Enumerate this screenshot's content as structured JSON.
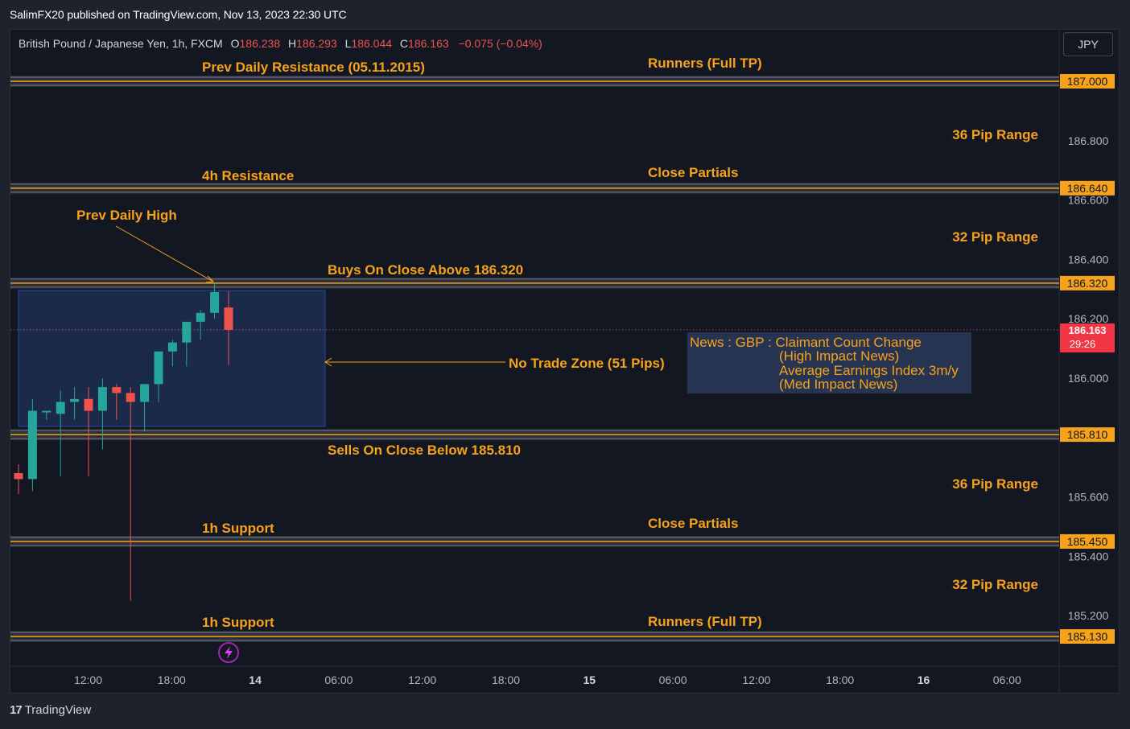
{
  "header": {
    "publisher": "SalimFX20 published on TradingView.com, Nov 13, 2023 22:30 UTC"
  },
  "legend": {
    "symbol": "British Pound / Japanese Yen, 1h, FXCM",
    "o_label": "O",
    "o_value": "186.238",
    "h_label": "H",
    "h_value": "186.293",
    "l_label": "L",
    "l_value": "186.044",
    "c_label": "C",
    "c_value": "186.163",
    "change": "−0.075 (−0.04%)"
  },
  "currency_button": "JPY",
  "footer": {
    "brand": "TradingView"
  },
  "colors": {
    "up": "#26a69a",
    "down": "#ef5350",
    "annotation": "#f7a21b",
    "background": "#131722",
    "zone_fill": "#1b2a48",
    "zone_border": "#2962ff"
  },
  "chart_data": {
    "type": "candlestick",
    "ylim": [
      185.03,
      187.09
    ],
    "price_axis_ticks": [
      "186.800",
      "186.600",
      "186.400",
      "186.200",
      "186.000",
      "185.600",
      "185.400",
      "185.200"
    ],
    "time_axis_ticks": [
      "12:00",
      "18:00",
      "14",
      "06:00",
      "12:00",
      "18:00",
      "15",
      "06:00",
      "12:00",
      "18:00",
      "16",
      "06:00"
    ],
    "candles": [
      {
        "o": 185.68,
        "h": 185.71,
        "l": 185.61,
        "c": 185.66
      },
      {
        "o": 185.66,
        "h": 185.93,
        "l": 185.62,
        "c": 185.89
      },
      {
        "o": 185.89,
        "h": 185.89,
        "l": 185.86,
        "c": 185.89
      },
      {
        "o": 185.88,
        "h": 185.96,
        "l": 185.67,
        "c": 185.92
      },
      {
        "o": 185.92,
        "h": 185.97,
        "l": 185.86,
        "c": 185.93
      },
      {
        "o": 185.93,
        "h": 185.97,
        "l": 185.67,
        "c": 185.89
      },
      {
        "o": 185.89,
        "h": 186.0,
        "l": 185.76,
        "c": 185.97
      },
      {
        "o": 185.97,
        "h": 185.98,
        "l": 185.86,
        "c": 185.95
      },
      {
        "o": 185.95,
        "h": 185.97,
        "l": 185.25,
        "c": 185.92
      },
      {
        "o": 185.92,
        "h": 185.98,
        "l": 185.82,
        "c": 185.98
      },
      {
        "o": 185.98,
        "h": 186.05,
        "l": 185.92,
        "c": 186.09
      },
      {
        "o": 186.09,
        "h": 186.13,
        "l": 186.04,
        "c": 186.12
      },
      {
        "o": 186.12,
        "h": 186.13,
        "l": 186.04,
        "c": 186.19
      },
      {
        "o": 186.19,
        "h": 186.23,
        "l": 186.13,
        "c": 186.22
      },
      {
        "o": 186.22,
        "h": 186.32,
        "l": 186.2,
        "c": 186.29
      },
      {
        "o": 186.238,
        "h": 186.293,
        "l": 186.044,
        "c": 186.163
      }
    ],
    "levels": [
      {
        "price": 187.0,
        "label": "187.000"
      },
      {
        "price": 186.64,
        "label": "186.640"
      },
      {
        "price": 186.32,
        "label": "186.320"
      },
      {
        "price": 185.81,
        "label": "185.810"
      },
      {
        "price": 185.45,
        "label": "185.450"
      },
      {
        "price": 185.13,
        "label": "185.130"
      }
    ],
    "current_price": {
      "label": "186.163",
      "countdown": "29:26"
    },
    "annotations": {
      "prev_daily_resistance": "Prev Daily Resistance (05.11.2015)",
      "runners_top": "Runners (Full TP)",
      "range_36_top": "36 Pip Range",
      "resistance_4h": "4h Resistance",
      "close_partials_top": "Close Partials",
      "prev_daily_high": "Prev Daily High",
      "range_32_top": "32 Pip Range",
      "buys": "Buys On Close Above 186.320",
      "no_trade": "No Trade Zone (51 Pips)",
      "sells": "Sells On Close Below 185.810",
      "range_36_bottom": "36 Pip Range",
      "support_1h_a": "1h Support",
      "close_partials_bottom": "Close Partials",
      "range_32_bottom": "32 Pip Range",
      "support_1h_b": "1h Support",
      "runners_bottom": "Runners (Full TP)"
    },
    "news": {
      "line1": "News : GBP : Claimant Count Change",
      "line2": "(High Impact News)",
      "line3": "Average Earnings Index 3m/y",
      "line4": "(Med Impact News)"
    }
  }
}
